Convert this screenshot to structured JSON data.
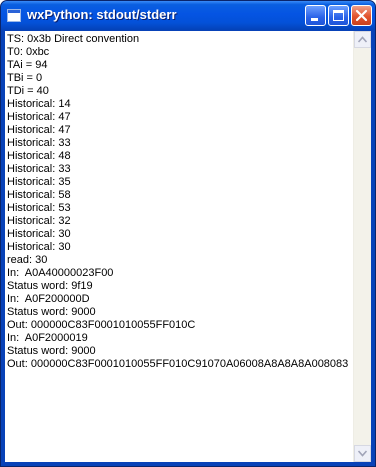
{
  "window": {
    "title": "wxPython: stdout/stderr"
  },
  "titlebar_buttons": {
    "minimize": "minimize-icon",
    "maximize": "maximize-icon",
    "close": "close-icon"
  },
  "output": {
    "lines": [
      "TS: 0x3b Direct convention",
      "T0: 0xbc",
      "TAi = 94",
      "TBi = 0",
      "TDi = 40",
      "Historical: 14",
      "Historical: 47",
      "Historical: 47",
      "Historical: 33",
      "Historical: 48",
      "Historical: 33",
      "Historical: 35",
      "Historical: 58",
      "Historical: 53",
      "Historical: 32",
      "Historical: 30",
      "Historical: 30",
      "read: 30",
      "In:  A0A40000023F00",
      "Status word: 9f19",
      "In:  A0F200000D",
      "Status word: 9000",
      "Out: 000000C83F0001010055FF010C",
      "In:  A0F2000019",
      "Status word: 9000",
      "Out: 000000C83F0001010055FF010C91070A06008A8A8A8A008083"
    ]
  },
  "scrollbar": {
    "up_icon": "scroll-up-arrow-icon",
    "down_icon": "scroll-down-arrow-icon"
  },
  "colors": {
    "titlebar": "#0554e3",
    "close_button": "#e2542e",
    "text": "#000000"
  }
}
